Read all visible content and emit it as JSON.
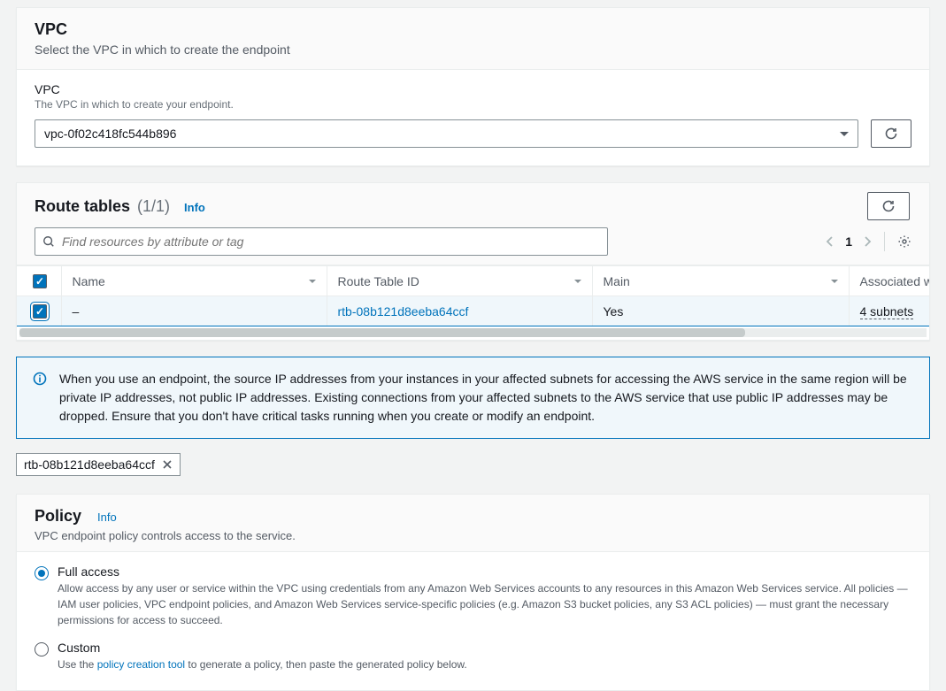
{
  "vpc_panel": {
    "title": "VPC",
    "subtitle": "Select the VPC in which to create the endpoint",
    "field_label": "VPC",
    "field_hint": "The VPC in which to create your endpoint.",
    "selected_value": "vpc-0f02c418fc544b896"
  },
  "route_tables": {
    "title": "Route tables",
    "count_label": "(1/1)",
    "info_label": "Info",
    "search_placeholder": "Find resources by attribute or tag",
    "page": "1",
    "columns": {
      "name": "Name",
      "rtid": "Route Table ID",
      "main": "Main",
      "assoc": "Associated with"
    },
    "rows": [
      {
        "selected": true,
        "name": "–",
        "rtid": "rtb-08b121d8eeba64ccf",
        "main": "Yes",
        "assoc": "4 subnets"
      }
    ]
  },
  "alert": {
    "text": "When you use an endpoint, the source IP addresses from your instances in your affected subnets for accessing the AWS service in the same region will be private IP addresses, not public IP addresses. Existing connections from your affected subnets to the AWS service that use public IP addresses may be dropped. Ensure that you don't have critical tasks running when you create or modify an endpoint."
  },
  "chip": {
    "label": "rtb-08b121d8eeba64ccf"
  },
  "policy": {
    "title": "Policy",
    "info_label": "Info",
    "subtitle": "VPC endpoint policy controls access to the service.",
    "options": [
      {
        "key": "full",
        "label": "Full access",
        "desc": "Allow access by any user or service within the VPC using credentials from any Amazon Web Services accounts to any resources in this Amazon Web Services service. All policies — IAM user policies, VPC endpoint policies, and Amazon Web Services service-specific policies (e.g. Amazon S3 bucket policies, any S3 ACL policies) — must grant the necessary permissions for access to succeed.",
        "checked": true
      },
      {
        "key": "custom",
        "label": "Custom",
        "desc_prefix": "Use the ",
        "desc_link": "policy creation tool",
        "desc_suffix": " to generate a policy, then paste the generated policy below.",
        "checked": false
      }
    ]
  }
}
